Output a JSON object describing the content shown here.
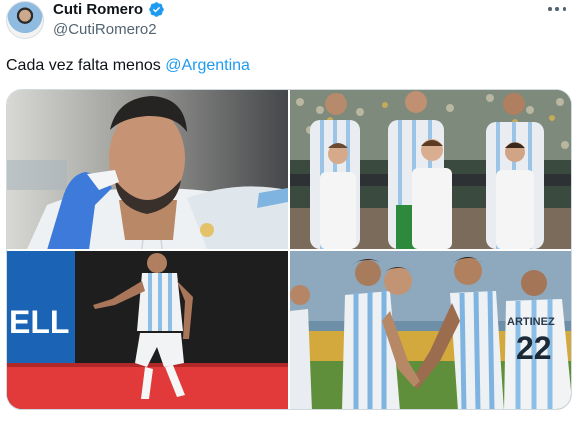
{
  "author": {
    "display_name": "Cuti Romero",
    "handle": "@CutiRomero2",
    "verified": true,
    "avatar_icon": "profile-avatar"
  },
  "tweet": {
    "text_prefix": "Cada vez falta menos ",
    "mention": "@Argentina"
  },
  "menu": {
    "icon": "more-horizontal-icon"
  },
  "media": {
    "count": 4,
    "photos": [
      {
        "icon": "photo",
        "subject": "player-closeup"
      },
      {
        "icon": "photo",
        "subject": "lineup-with-kids"
      },
      {
        "icon": "photo",
        "subject": "player-running"
      },
      {
        "icon": "photo",
        "subject": "players-celebrating"
      }
    ],
    "jersey_text": "ARTINEZ",
    "jersey_number": "22",
    "banner_text": "ELL"
  },
  "colors": {
    "accent": "#1d9bf0",
    "text": "#0f1419",
    "secondary_text": "#536471",
    "border": "#cfd9de"
  }
}
